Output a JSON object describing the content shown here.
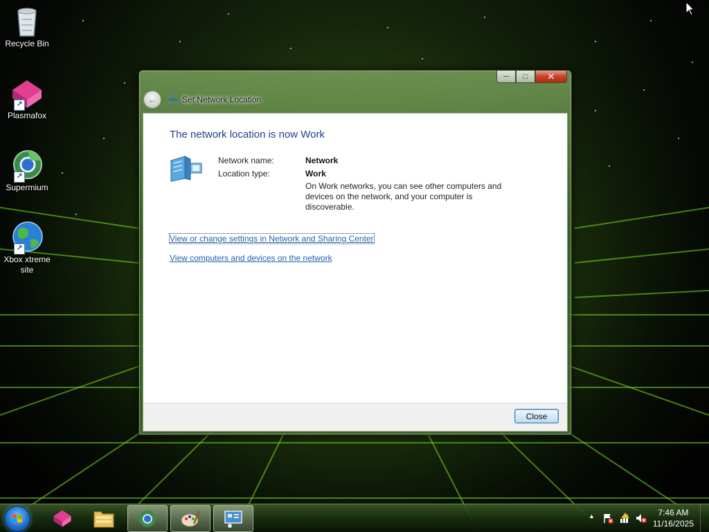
{
  "desktop": {
    "icons": [
      {
        "label": "Recycle Bin",
        "icon": "recycle-bin-icon"
      },
      {
        "label": "Plasmafox",
        "icon": "plasmafox-icon"
      },
      {
        "label": "Supermium",
        "icon": "supermium-icon"
      },
      {
        "label": "Xbox xtreme site",
        "icon": "globe-icon"
      }
    ]
  },
  "window": {
    "title": "Set Network Location",
    "controls": {
      "minimize": "minimize-icon",
      "maximize": "maximize-icon",
      "close": "close-icon"
    },
    "heading": "The network location is now Work",
    "network_name_label": "Network name:",
    "network_name_value": "Network",
    "location_type_label": "Location type:",
    "location_type_value": "Work",
    "description": "On Work networks, you can see other computers and devices on the network, and your computer is discoverable.",
    "links": [
      {
        "label": "View or change settings in Network and Sharing Center"
      },
      {
        "label": "View computers and devices on the network"
      }
    ],
    "close_button": "Close"
  },
  "taskbar": {
    "pinned": [
      {
        "icon": "plasmafox-icon"
      },
      {
        "icon": "file-explorer-icon"
      },
      {
        "icon": "supermium-icon"
      },
      {
        "icon": "paint-icon"
      },
      {
        "icon": "network-location-icon"
      }
    ],
    "tray": {
      "icons": [
        "show-hidden-icons-arrow",
        "action-center-flag-icon",
        "network-icon",
        "volume-muted-icon"
      ]
    },
    "clock": {
      "time": "7:46 AM",
      "date": "11/16/2025"
    }
  },
  "colors": {
    "heading": "#1e3f8f",
    "link": "#1f5fae",
    "window_frame": "#4a7a32",
    "desktop_grid": "#6fd21f"
  }
}
